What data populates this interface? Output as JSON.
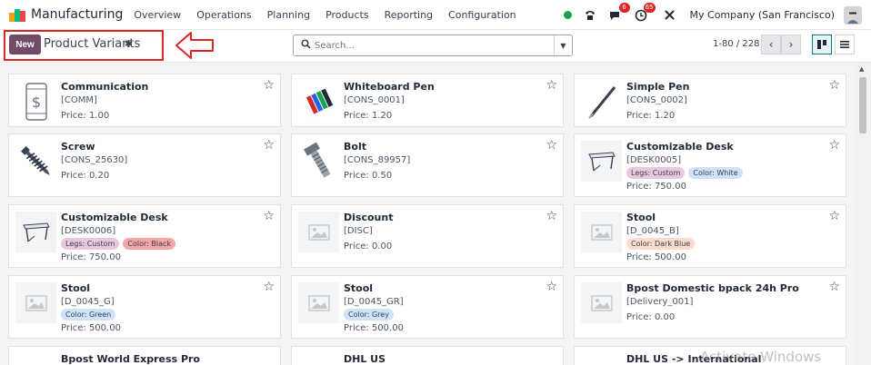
{
  "navbar": {
    "app_name": "Manufacturing",
    "menu": [
      "Overview",
      "Operations",
      "Planning",
      "Products",
      "Reporting",
      "Configuration"
    ],
    "chat_badge": "6",
    "activity_badge": "65",
    "company": "My Company (San Francisco)"
  },
  "control": {
    "new_label": "New",
    "title": "Product Variants",
    "search_placeholder": "Search...",
    "pager": "1-80 / 228"
  },
  "colors": {
    "brand": "#714b67",
    "annotation": "#dc2626",
    "status_online": "#16a34a"
  },
  "cards": [
    {
      "name": "Communication",
      "code": "[COMM]",
      "price": "Price: 1.00",
      "tags": [],
      "image": "phone-dollar"
    },
    {
      "name": "Whiteboard Pen",
      "code": "[CONS_0001]",
      "price": "Price: 1.20",
      "tags": [],
      "image": "pens"
    },
    {
      "name": "Simple Pen",
      "code": "[CONS_0002]",
      "price": "Price: 1.20",
      "tags": [],
      "image": "pen"
    },
    {
      "name": "Screw",
      "code": "[CONS_25630]",
      "price": "Price: 0.20",
      "tags": [],
      "image": "screw"
    },
    {
      "name": "Bolt",
      "code": "[CONS_89957]",
      "price": "Price: 0.50",
      "tags": [],
      "image": "bolt"
    },
    {
      "name": "Customizable Desk",
      "code": "[DESK0005]",
      "price": "Price: 750.00",
      "tags": [
        {
          "text": "Legs: Custom",
          "color": "#e9c7df"
        },
        {
          "text": "Color: White",
          "color": "#cfe2f7"
        }
      ],
      "image": "desk"
    },
    {
      "name": "Customizable Desk",
      "code": "[DESK0006]",
      "price": "Price: 750.00",
      "tags": [
        {
          "text": "Legs: Custom",
          "color": "#e9c7df"
        },
        {
          "text": "Color: Black",
          "color": "#f4a6a6"
        }
      ],
      "image": "desk"
    },
    {
      "name": "Discount",
      "code": "[DISC]",
      "price": "Price: 0.00",
      "tags": [],
      "image": "placeholder"
    },
    {
      "name": "Stool",
      "code": "[D_0045_B]",
      "price": "Price: 500.00",
      "tags": [
        {
          "text": "Color: Dark Blue",
          "color": "#fbdccc"
        }
      ],
      "image": "placeholder"
    },
    {
      "name": "Stool",
      "code": "[D_0045_G]",
      "price": "Price: 500.00",
      "tags": [
        {
          "text": "Color: Green",
          "color": "#cfe2f7"
        }
      ],
      "image": "placeholder"
    },
    {
      "name": "Stool",
      "code": "[D_0045_GR]",
      "price": "Price: 500.00",
      "tags": [
        {
          "text": "Color: Grey",
          "color": "#cfe2f7"
        }
      ],
      "image": "placeholder"
    },
    {
      "name": "Bpost Domestic bpack 24h Pro",
      "code": "[Delivery_001]",
      "price": "Price: 0.00",
      "tags": [],
      "image": "placeholder"
    },
    {
      "name": "Bpost World Express Pro",
      "code": "",
      "price": "",
      "tags": [],
      "image": "placeholder"
    },
    {
      "name": "DHL US",
      "code": "",
      "price": "",
      "tags": [],
      "image": "placeholder"
    },
    {
      "name": "DHL US -> International",
      "code": "",
      "price": "",
      "tags": [],
      "image": "placeholder"
    }
  ],
  "watermark": "Activate Windows"
}
